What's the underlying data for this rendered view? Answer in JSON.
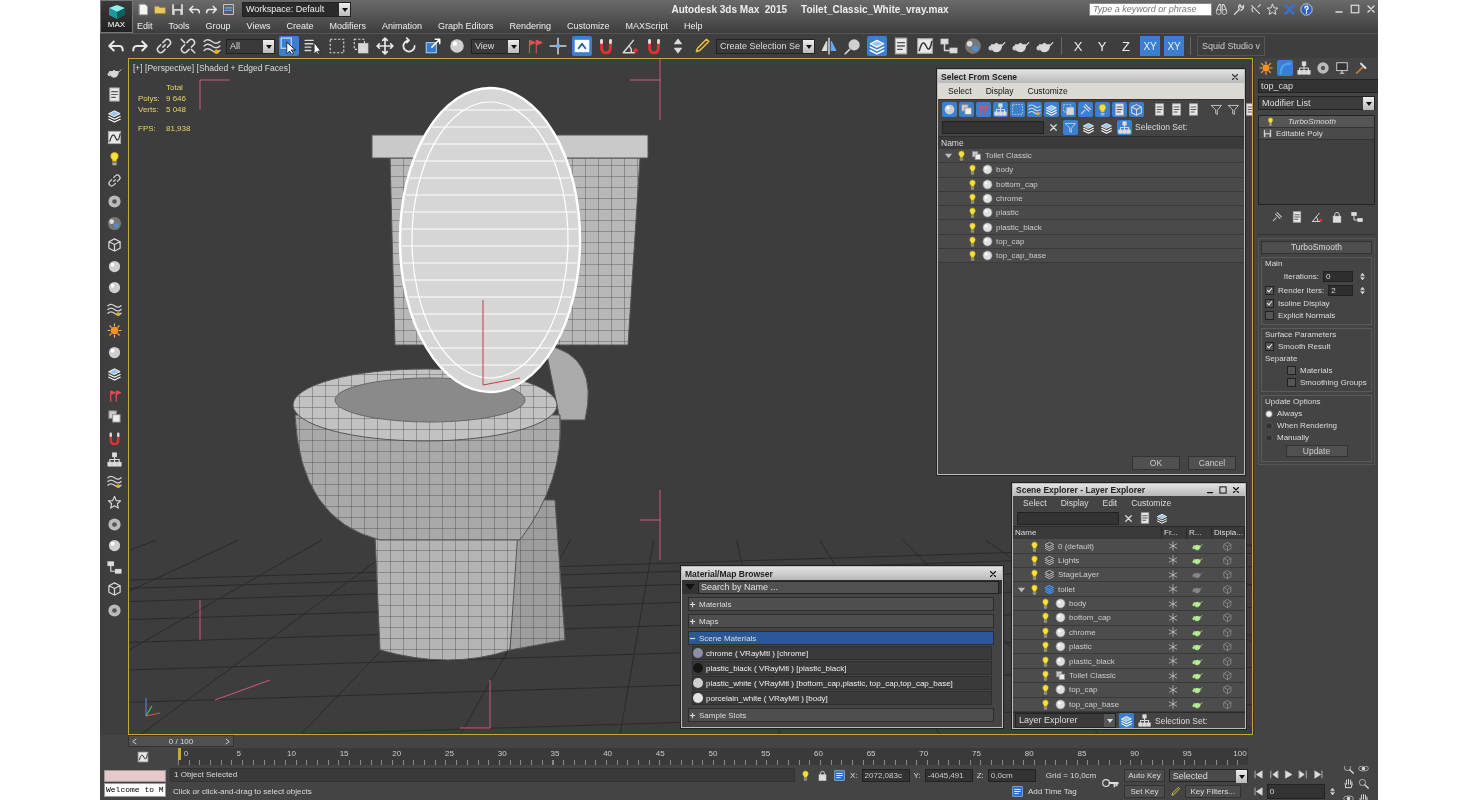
{
  "title_bar": {
    "logo_text": "MAX",
    "workspace": "Workspace: Default",
    "app_title": "Autodesk 3ds Max  2015",
    "file_name": "Toilet_Classic_White_vray.max",
    "search": {
      "placeholder": "Type a keyword or phrase"
    }
  },
  "menu": [
    "Edit",
    "Tools",
    "Group",
    "Views",
    "Create",
    "Modifiers",
    "Animation",
    "Graph Editors",
    "Rendering",
    "Customize",
    "MAXScript",
    "Help"
  ],
  "toolbar": {
    "selection_filter": "All",
    "reference_coord": "View",
    "named_selection": "Create Selection Se",
    "tools_a": [
      {
        "kind": "undo",
        "selected": false
      },
      {
        "kind": "redo",
        "selected": false
      },
      {
        "kind": "link",
        "selected": false
      },
      {
        "kind": "unlink",
        "selected": false
      },
      {
        "kind": "wave",
        "selected": false
      }
    ],
    "tools_b": [
      {
        "kind": "cursor",
        "selected": true
      },
      {
        "kind": "list",
        "selected": false
      },
      {
        "kind": "rect",
        "selected": false
      },
      {
        "kind": "window",
        "selected": false
      },
      {
        "kind": "move",
        "selected": false
      },
      {
        "kind": "rotate",
        "selected": false
      },
      {
        "kind": "scale",
        "selected": false
      },
      {
        "kind": "sphere",
        "selected": false
      }
    ],
    "tools_c": [
      {
        "kind": "flags",
        "selected": false
      },
      {
        "kind": "cross",
        "selected": false
      },
      {
        "kind": "keyboard",
        "selected": true
      },
      {
        "kind": "magnet",
        "selected": false
      },
      {
        "kind": "angle",
        "selected": false
      },
      {
        "kind": "magnet",
        "selected": false
      },
      {
        "kind": "spinner",
        "selected": false
      },
      {
        "kind": "pencil",
        "selected": false
      }
    ],
    "tools_d": [
      {
        "kind": "mirror",
        "selected": false
      },
      {
        "kind": "align",
        "selected": false
      },
      {
        "kind": "layers",
        "selected": true
      },
      {
        "kind": "explorer",
        "selected": false
      },
      {
        "kind": "curve",
        "selected": false
      },
      {
        "kind": "schematic",
        "selected": false
      },
      {
        "kind": "material",
        "selected": false
      },
      {
        "kind": "teapot",
        "selected": false
      },
      {
        "kind": "teapot",
        "selected": false
      },
      {
        "kind": "teapot",
        "selected": false
      }
    ],
    "axes": [
      {
        "label": "X",
        "selected": false
      },
      {
        "label": "Y",
        "selected": false
      },
      {
        "label": "Z",
        "selected": false
      },
      {
        "label": "XY",
        "selected": true
      },
      {
        "label": "XY",
        "selected": true
      }
    ],
    "workspace_label": "Squid Studio v"
  },
  "viewport": {
    "label": "[+] [Perspective] [Shaded + Edged Faces]",
    "stats": {
      "total_label": "Total",
      "rows": [
        {
          "label": "Polys:",
          "value": "9 646"
        },
        {
          "label": "Verts:",
          "value": "5 048"
        }
      ],
      "fps_label": "FPS:",
      "fps": "81,938"
    }
  },
  "select_from_scene": {
    "title": "Select From Scene",
    "menu": [
      "Select",
      "Display",
      "Customize"
    ],
    "selection_set": "Selection Set:",
    "column": "Name",
    "rows": [
      {
        "name": "Toilet Classic",
        "kind": "group",
        "expanded": true,
        "children": [
          {
            "name": "body",
            "kind": "object"
          },
          {
            "name": "bottom_cap",
            "kind": "object"
          },
          {
            "name": "chrome",
            "kind": "object"
          },
          {
            "name": "plastic",
            "kind": "object"
          },
          {
            "name": "plastic_black",
            "kind": "object"
          },
          {
            "name": "top_cap",
            "kind": "object"
          },
          {
            "name": "top_cap_base",
            "kind": "object"
          }
        ]
      }
    ],
    "buttons": [
      "OK",
      "Cancel"
    ]
  },
  "material_browser": {
    "title": "Material/Map Browser",
    "search": {
      "placeholder": "Search by Name ..."
    },
    "sections": [
      {
        "label": "Materials",
        "expanded": false
      },
      {
        "label": "Maps",
        "expanded": false
      },
      {
        "label": "Scene Materials",
        "expanded": true,
        "items": [
          {
            "label": "chrome  ( VRayMtl ) [chrome]",
            "color": "#8a90a8"
          },
          {
            "label": "plastic_black  ( VRayMtl ) [plastic_black]",
            "color": "#151515"
          },
          {
            "label": "plastic_white  ( VRayMtl ) [bottom_cap,plastic, top_cap,top_cap_base]",
            "color": "#d0d0d0"
          },
          {
            "label": "porcelain_white  ( VRayMtl ) [body]",
            "color": "#e4e4e4"
          }
        ]
      },
      {
        "label": "Sample Slots",
        "expanded": false
      }
    ]
  },
  "scene_explorer": {
    "title": "Scene Explorer - Layer Explorer",
    "menu": [
      "Select",
      "Display",
      "Edit",
      "Customize"
    ],
    "columns": [
      "Name",
      "Fr...",
      "R...",
      "Displa..."
    ],
    "rows": [
      {
        "name": "0 (default)",
        "kind": "layer",
        "renderable": true
      },
      {
        "name": "Lights",
        "kind": "layer",
        "renderable": true
      },
      {
        "name": "StageLayer",
        "kind": "layer",
        "renderable": false
      },
      {
        "name": "toilet",
        "kind": "active_layer",
        "renderable": false,
        "expanded": true,
        "children": [
          {
            "name": "body",
            "kind": "object",
            "renderable": true
          },
          {
            "name": "bottom_cap",
            "kind": "object",
            "renderable": true
          },
          {
            "name": "chrome",
            "kind": "object",
            "renderable": true
          },
          {
            "name": "plastic",
            "kind": "object",
            "renderable": true
          },
          {
            "name": "plastic_black",
            "kind": "object",
            "renderable": true
          },
          {
            "name": "Toilet Classic",
            "kind": "group",
            "renderable": true
          },
          {
            "name": "top_cap",
            "kind": "object",
            "renderable": true
          },
          {
            "name": "top_cap_base",
            "kind": "object",
            "renderable": true
          }
        ]
      }
    ],
    "footer_mode": "Layer Explorer",
    "selection_set": "Selection Set:"
  },
  "command_panel": {
    "tabs": [
      {
        "kind": "sun",
        "selected": false
      },
      {
        "kind": "arc",
        "selected": true
      },
      {
        "kind": "tree",
        "selected": false
      },
      {
        "kind": "disc",
        "selected": false
      },
      {
        "kind": "monitor",
        "selected": false
      },
      {
        "kind": "hammer",
        "selected": false
      }
    ],
    "object_name": "top_cap",
    "modifier_list": "Modifier List",
    "stack": [
      {
        "label": "TurboSmooth",
        "kind": "modifier"
      },
      {
        "label": "Editable Poly",
        "kind": "base"
      }
    ],
    "rollout": {
      "title": "TurboSmooth",
      "main_title": "Main",
      "iterations": {
        "label": "Iterations:",
        "value": "0"
      },
      "render_iters": {
        "label": "Render Iters:",
        "checked": true,
        "value": "2"
      },
      "main_checks": [
        {
          "label": "Isoline Display",
          "checked": true
        },
        {
          "label": "Explicit Normals",
          "checked": false
        }
      ],
      "surface_title": "Surface Parameters",
      "smooth_result": {
        "label": "Smooth Result",
        "checked": true
      },
      "separate": "Separate",
      "separate_checks": [
        {
          "label": "Materials",
          "checked": false
        },
        {
          "label": "Smoothing Groups",
          "checked": false
        }
      ],
      "update_title": "Update Options",
      "update_options": [
        {
          "label": "Always",
          "selected": true
        },
        {
          "label": "When Rendering",
          "selected": false
        },
        {
          "label": "Manually",
          "selected": false
        }
      ],
      "update_button": "Update"
    }
  },
  "timeline": {
    "position": "0 / 100",
    "ticks": [
      "0",
      "5",
      "10",
      "15",
      "20",
      "25",
      "30",
      "35",
      "40",
      "45",
      "50",
      "55",
      "60",
      "65",
      "70",
      "75",
      "80",
      "85",
      "90",
      "95",
      "100"
    ]
  },
  "status": {
    "prompt_box": "Welcome to M",
    "selection": "1 Object Selected",
    "hint": "Click or click-and-drag to select objects",
    "coords": [
      {
        "label": "X:",
        "value": "2072,083c"
      },
      {
        "label": "Y:",
        "value": "-4045,491"
      },
      {
        "label": "Z:",
        "value": "0,0cm"
      }
    ],
    "grid": "Grid = 10,0cm",
    "add_time_tag": "Add Time Tag",
    "auto_key": "Auto Key",
    "key_mode": "Selected",
    "set_key": "Set Key",
    "key_filters": "Key Filters...",
    "frame": "0"
  }
}
